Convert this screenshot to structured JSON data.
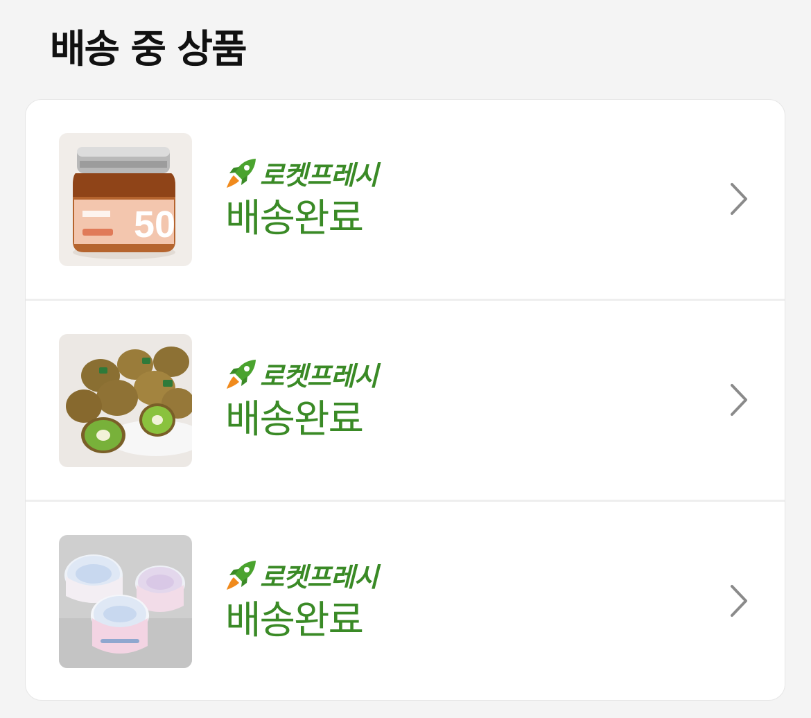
{
  "section": {
    "title": "배송 중 상품"
  },
  "items": [
    {
      "image": "jam-jar-image",
      "badge_label": "로켓프레시",
      "status": "배송완료"
    },
    {
      "image": "kiwi-image",
      "badge_label": "로켓프레시",
      "status": "배송완료"
    },
    {
      "image": "greek-yogurt-image",
      "badge_label": "로켓프레시",
      "status": "배송완료"
    }
  ],
  "icons": {
    "badge": "rocket-icon",
    "row_action": "chevron-right-icon"
  },
  "colors": {
    "background": "#f4f4f4",
    "card": "#ffffff",
    "accent_green": "#3a8a26",
    "title": "#111111",
    "chevron": "#8a8a8a"
  }
}
